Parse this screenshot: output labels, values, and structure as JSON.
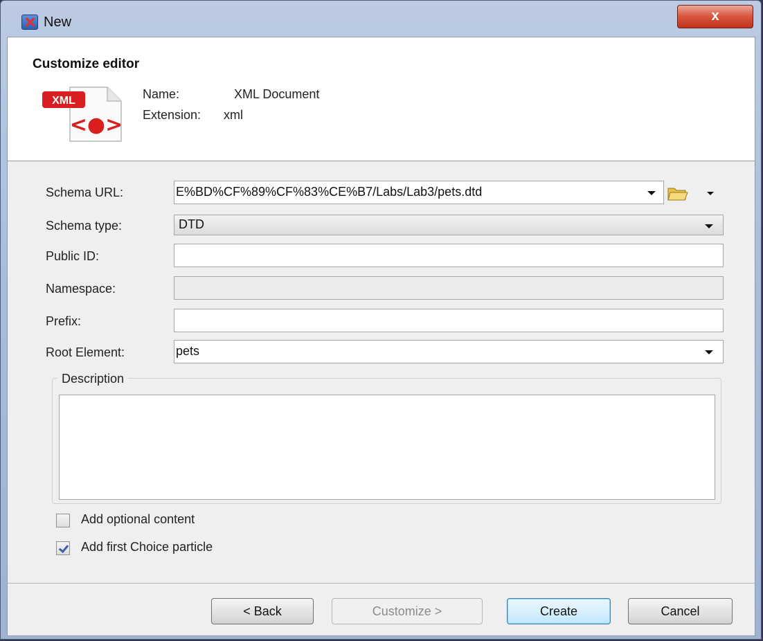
{
  "window": {
    "title": "New",
    "close_glyph": "x"
  },
  "header": {
    "title": "Customize editor",
    "icon_badge": "XML",
    "icon_glyph": "<●>",
    "name_label": "Name:",
    "name_value": "XML Document",
    "extension_label": "Extension:",
    "extension_value": "xml"
  },
  "form": {
    "schema_url_label": "Schema URL:",
    "schema_url_value": "E%BD%CF%89%CF%83%CE%B7/Labs/Lab3/pets.dtd",
    "schema_type_label": "Schema type:",
    "schema_type_value": "DTD",
    "public_id_label": "Public ID:",
    "public_id_value": "",
    "namespace_label": "Namespace:",
    "namespace_value": "",
    "prefix_label": "Prefix:",
    "prefix_value": "",
    "root_element_label": "Root Element:",
    "root_element_value": "pets"
  },
  "description": {
    "legend": "Description",
    "value": ""
  },
  "options": {
    "optional_content_label": "Add optional content",
    "optional_content_checked": false,
    "first_choice_label": "Add first Choice particle",
    "first_choice_checked": true
  },
  "buttons": {
    "back": "< Back",
    "customize": "Customize >",
    "create": "Create",
    "cancel": "Cancel"
  },
  "colors": {
    "accent": "#3c5da8",
    "close": "#c1321b",
    "xml_badge": "#d81e1e"
  }
}
